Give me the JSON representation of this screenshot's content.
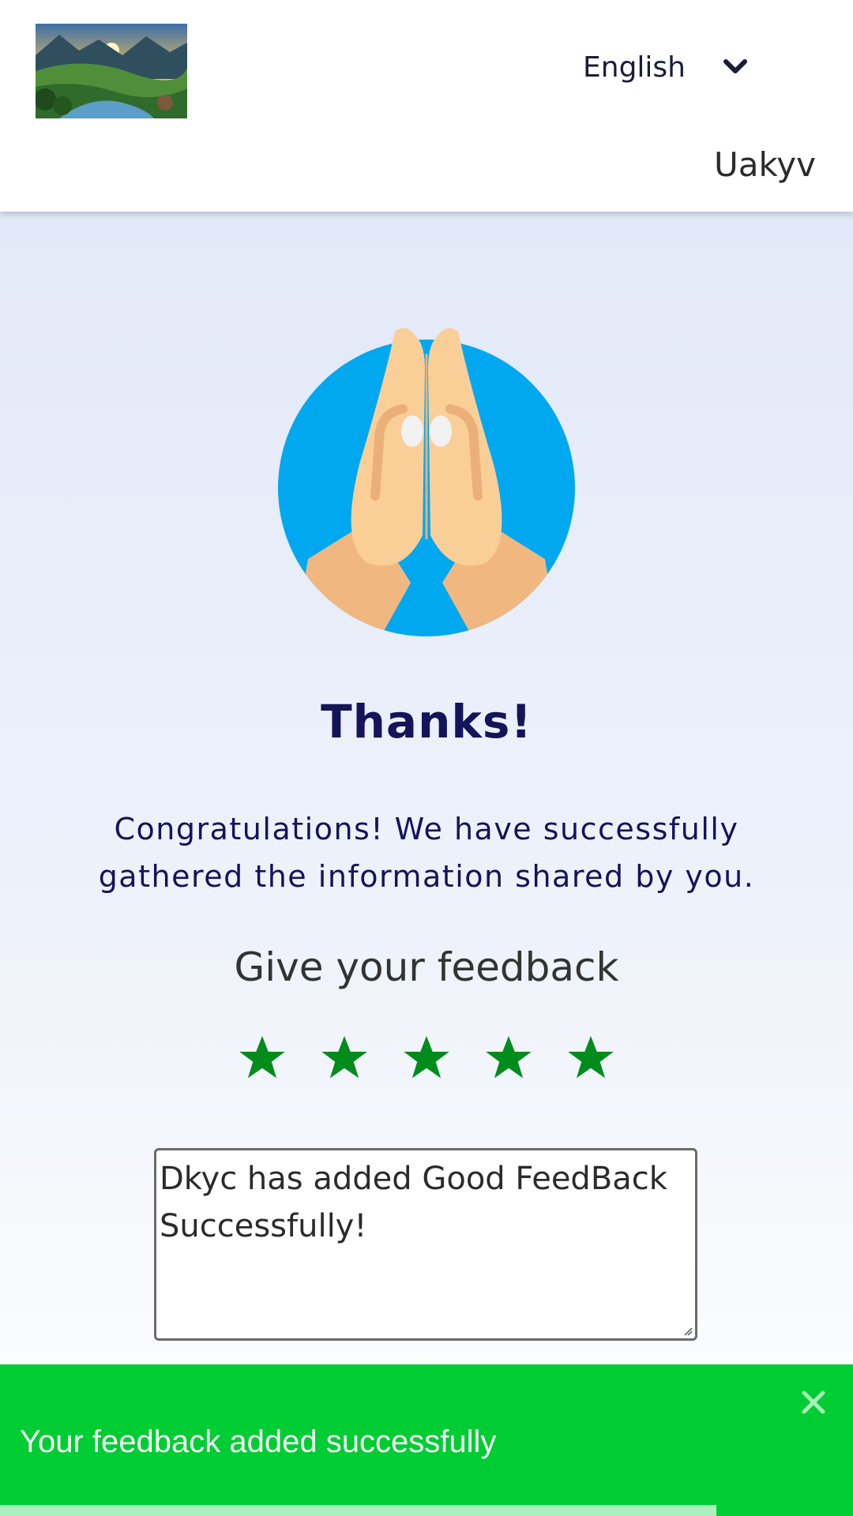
{
  "header": {
    "logo_icon": "landscape-logo",
    "language": {
      "selected": "English",
      "icon": "chevron-down-icon"
    },
    "username": "Uakyv"
  },
  "main": {
    "hero_icon": "praying-hands-icon",
    "title": "Thanks!",
    "message_line1": "Congratulations! We have successfully",
    "message_line2": "gathered the information shared by you.",
    "feedback_heading": "Give your feedback",
    "rating": {
      "value": 5,
      "max": 5,
      "color": "#008c1c"
    },
    "feedback_text_line1": "Dkyc has added Good FeedBack",
    "feedback_text_line2": "Successfully!"
  },
  "toast": {
    "message": "Your feedback added successfully",
    "close_icon": "close-icon",
    "background": "#00cc33",
    "progress": 0.84
  }
}
